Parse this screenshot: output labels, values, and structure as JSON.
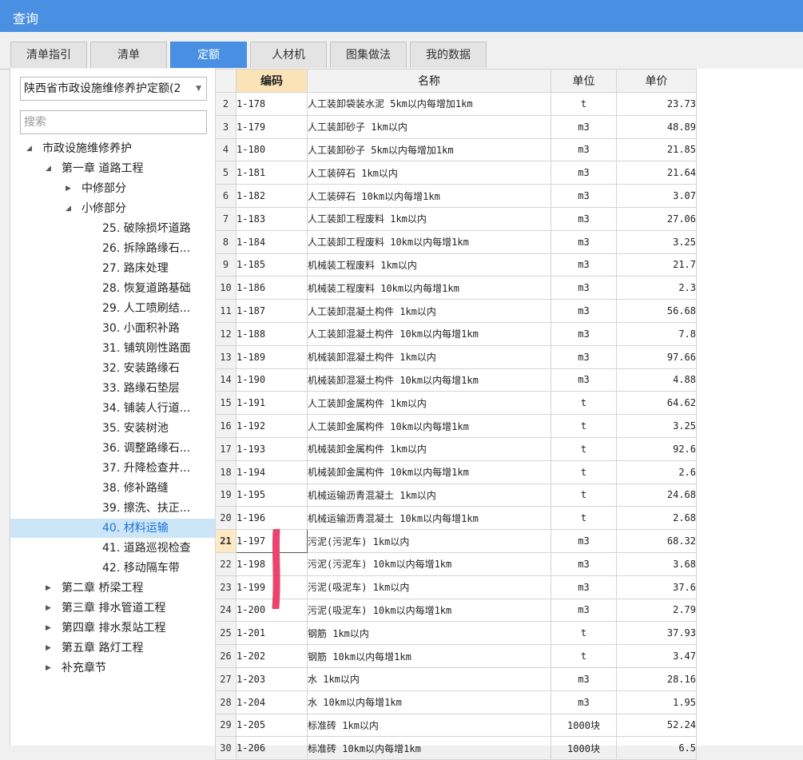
{
  "window": {
    "title": "查询"
  },
  "tabs": [
    {
      "label": "清单指引",
      "active": false
    },
    {
      "label": "清单",
      "active": false
    },
    {
      "label": "定额",
      "active": true
    },
    {
      "label": "人材机",
      "active": false
    },
    {
      "label": "图集做法",
      "active": false
    },
    {
      "label": "我的数据",
      "active": false
    }
  ],
  "left": {
    "dropdown_value": "陕西省市政设施维修养护定额(2",
    "search_placeholder": "搜索",
    "tree": [
      {
        "label": "市政设施维修养护",
        "level": 0,
        "state": "expanded"
      },
      {
        "label": "第一章 道路工程",
        "level": 1,
        "state": "expanded"
      },
      {
        "label": "中修部分",
        "level": 2,
        "state": "collapsed"
      },
      {
        "label": "小修部分",
        "level": 2,
        "state": "expanded"
      },
      {
        "label": "25. 破除损坏道路",
        "level": 3,
        "state": "leaf"
      },
      {
        "label": "26. 拆除路缘石...",
        "level": 3,
        "state": "leaf"
      },
      {
        "label": "27. 路床处理",
        "level": 3,
        "state": "leaf"
      },
      {
        "label": "28. 恢复道路基础",
        "level": 3,
        "state": "leaf"
      },
      {
        "label": "29. 人工喷刷结...",
        "level": 3,
        "state": "leaf"
      },
      {
        "label": "30. 小面积补路",
        "level": 3,
        "state": "leaf"
      },
      {
        "label": "31. 铺筑刚性路面",
        "level": 3,
        "state": "leaf"
      },
      {
        "label": "32. 安装路缘石",
        "level": 3,
        "state": "leaf"
      },
      {
        "label": "33. 路缘石垫层",
        "level": 3,
        "state": "leaf"
      },
      {
        "label": "34. 铺装人行道...",
        "level": 3,
        "state": "leaf"
      },
      {
        "label": "35. 安装树池",
        "level": 3,
        "state": "leaf"
      },
      {
        "label": "36. 调整路缘石...",
        "level": 3,
        "state": "leaf"
      },
      {
        "label": "37. 升降检查井...",
        "level": 3,
        "state": "leaf"
      },
      {
        "label": "38. 修补路缝",
        "level": 3,
        "state": "leaf"
      },
      {
        "label": "39. 擦洗、扶正...",
        "level": 3,
        "state": "leaf"
      },
      {
        "label": "40. 材料运输",
        "level": 3,
        "state": "leaf",
        "selected": true
      },
      {
        "label": "41. 道路巡视检查",
        "level": 3,
        "state": "leaf"
      },
      {
        "label": "42. 移动隔车带",
        "level": 3,
        "state": "leaf"
      },
      {
        "label": "第二章 桥梁工程",
        "level": 1,
        "state": "collapsed"
      },
      {
        "label": "第三章 排水管道工程",
        "level": 1,
        "state": "collapsed"
      },
      {
        "label": "第四章 排水泵站工程",
        "level": 1,
        "state": "collapsed"
      },
      {
        "label": "第五章 路灯工程",
        "level": 1,
        "state": "collapsed"
      },
      {
        "label": "补充章节",
        "level": 1,
        "state": "collapsed"
      }
    ]
  },
  "grid": {
    "columns": [
      "编码",
      "名称",
      "单位",
      "单价"
    ],
    "current_row": "21",
    "rows": [
      {
        "n": "2",
        "code": "1-178",
        "name": "人工装卸袋装水泥 5km以内每增加1km",
        "unit": "t",
        "price": "23.73"
      },
      {
        "n": "3",
        "code": "1-179",
        "name": "人工装卸砂子 1km以内",
        "unit": "m3",
        "price": "48.89"
      },
      {
        "n": "4",
        "code": "1-180",
        "name": "人工装卸砂子 5km以内每增加1km",
        "unit": "m3",
        "price": "21.85"
      },
      {
        "n": "5",
        "code": "1-181",
        "name": "人工装碎石 1km以内",
        "unit": "m3",
        "price": "21.64"
      },
      {
        "n": "6",
        "code": "1-182",
        "name": "人工装碎石 10km以内每增1km",
        "unit": "m3",
        "price": "3.07"
      },
      {
        "n": "7",
        "code": "1-183",
        "name": "人工装卸工程废料 1km以内",
        "unit": "m3",
        "price": "27.06"
      },
      {
        "n": "8",
        "code": "1-184",
        "name": "人工装卸工程废料 10km以内每增1km",
        "unit": "m3",
        "price": "3.25"
      },
      {
        "n": "9",
        "code": "1-185",
        "name": "机械装工程废料 1km以内",
        "unit": "m3",
        "price": "21.7"
      },
      {
        "n": "10",
        "code": "1-186",
        "name": "机械装工程废料 10km以内每增1km",
        "unit": "m3",
        "price": "2.3"
      },
      {
        "n": "11",
        "code": "1-187",
        "name": "人工装卸混凝土构件 1km以内",
        "unit": "m3",
        "price": "56.68"
      },
      {
        "n": "12",
        "code": "1-188",
        "name": "人工装卸混凝土构件 10km以内每增1km",
        "unit": "m3",
        "price": "7.8"
      },
      {
        "n": "13",
        "code": "1-189",
        "name": "机械装卸混凝土构件 1km以内",
        "unit": "m3",
        "price": "97.66"
      },
      {
        "n": "14",
        "code": "1-190",
        "name": "机械装卸混凝土构件 10km以内每增1km",
        "unit": "m3",
        "price": "4.88"
      },
      {
        "n": "15",
        "code": "1-191",
        "name": "人工装卸金属构件 1km以内",
        "unit": "t",
        "price": "64.62"
      },
      {
        "n": "16",
        "code": "1-192",
        "name": "人工装卸金属构件 10km以内每增1km",
        "unit": "t",
        "price": "3.25"
      },
      {
        "n": "17",
        "code": "1-193",
        "name": "机械装卸金属构件 1km以内",
        "unit": "t",
        "price": "92.6"
      },
      {
        "n": "18",
        "code": "1-194",
        "name": "机械装卸金属构件 10km以内每增1km",
        "unit": "t",
        "price": "2.6"
      },
      {
        "n": "19",
        "code": "1-195",
        "name": "机械运输沥青混凝土 1km以内",
        "unit": "t",
        "price": "24.68"
      },
      {
        "n": "20",
        "code": "1-196",
        "name": "机械运输沥青混凝土 10km以内每增1km",
        "unit": "t",
        "price": "2.68"
      },
      {
        "n": "21",
        "code": "1-197",
        "name": "污泥(污泥车) 1km以内",
        "unit": "m3",
        "price": "68.32"
      },
      {
        "n": "22",
        "code": "1-198",
        "name": "污泥(污泥车) 10km以内每增1km",
        "unit": "m3",
        "price": "3.68"
      },
      {
        "n": "23",
        "code": "1-199",
        "name": "污泥(吸泥车) 1km以内",
        "unit": "m3",
        "price": "37.6"
      },
      {
        "n": "24",
        "code": "1-200",
        "name": "污泥(吸泥车) 10km以内每增1km",
        "unit": "m3",
        "price": "2.79"
      },
      {
        "n": "25",
        "code": "1-201",
        "name": "钢筋 1km以内",
        "unit": "t",
        "price": "37.93"
      },
      {
        "n": "26",
        "code": "1-202",
        "name": "钢筋 10km以内每增1km",
        "unit": "t",
        "price": "3.47"
      },
      {
        "n": "27",
        "code": "1-203",
        "name": "水 1km以内",
        "unit": "m3",
        "price": "28.16"
      },
      {
        "n": "28",
        "code": "1-204",
        "name": "水 10km以内每增1km",
        "unit": "m3",
        "price": "1.95"
      },
      {
        "n": "29",
        "code": "1-205",
        "name": "标准砖 1km以内",
        "unit": "1000块",
        "price": "52.24"
      },
      {
        "n": "30",
        "code": "1-206",
        "name": "标准砖 10km以内每增1km",
        "unit": "1000块",
        "price": "6.5"
      }
    ]
  },
  "colors": {
    "accent": "#4a90e2",
    "selected_tree_bg": "#cde6f7",
    "code_header_bg": "#fbe3b8",
    "annotation": "#e8456e"
  }
}
